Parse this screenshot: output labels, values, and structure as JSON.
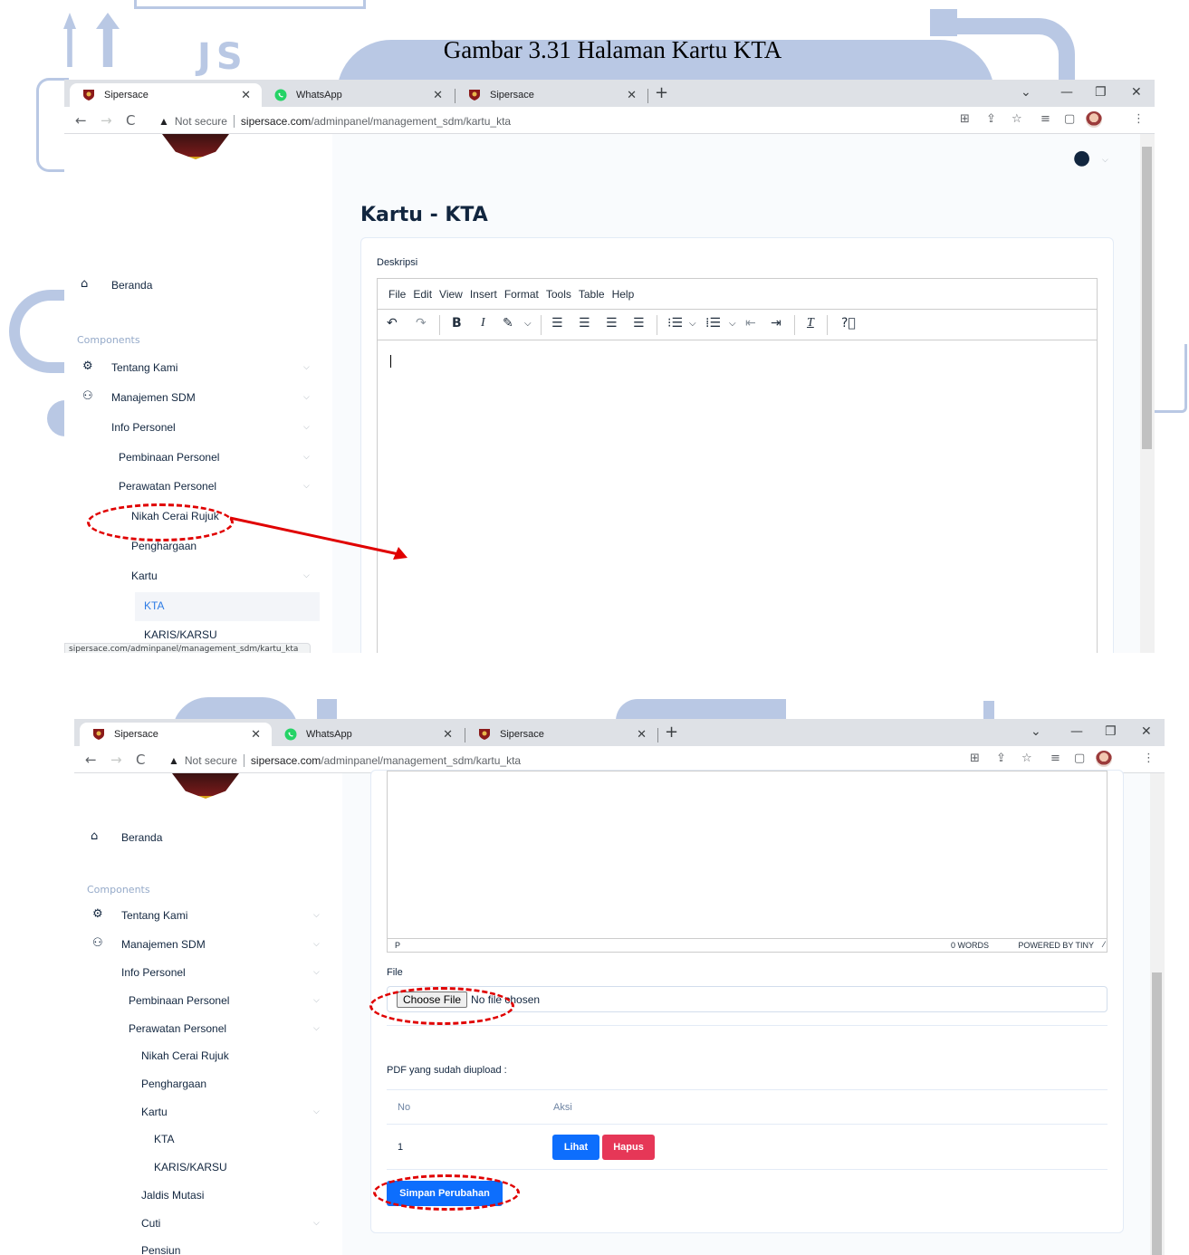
{
  "caption": "Gambar 3.31 Halaman Kartu KTA",
  "watermark_text": "JS",
  "browser": {
    "tabs": [
      {
        "label": "Sipersace",
        "active": true
      },
      {
        "label": "WhatsApp",
        "active": false
      },
      {
        "label": "Sipersace",
        "active": false
      }
    ],
    "new_tab": "+",
    "security_label": "Not secure",
    "url_host": "sipersace.com",
    "url_path": "/adminpanel/management_sdm/kartu_kta",
    "status_url": "sipersace.com/adminpanel/management_sdm/kartu_kta"
  },
  "sidebar": {
    "beranda": "Beranda",
    "section": "Components",
    "items": {
      "tentang": "Tentang Kami",
      "manajemen": "Manajemen SDM",
      "info": "Info Personel",
      "pembinaan": "Pembinaan Personel",
      "perawatan": "Perawatan Personel",
      "nikah": "Nikah Cerai Rujuk",
      "penghargaan": "Penghargaan",
      "kartu": "Kartu",
      "kta": "KTA",
      "karis": "KARIS/KARSU",
      "jaldis": "Jaldis Mutasi",
      "cuti": "Cuti",
      "pensiun": "Pensiun"
    }
  },
  "main": {
    "title": "Kartu - KTA",
    "desc_label": "Deskripsi",
    "menu": [
      "File",
      "Edit",
      "View",
      "Insert",
      "Format",
      "Tools",
      "Table",
      "Help"
    ],
    "editor_status_path": "P",
    "editor_words": "0 WORDS",
    "editor_powered": "POWERED BY TINY",
    "file_label": "File",
    "choose_file": "Choose File",
    "no_file": "No file chosen",
    "uploaded_label": "PDF yang sudah diupload :",
    "table_headers": [
      "No",
      "Aksi"
    ],
    "rows": [
      {
        "no": "1"
      }
    ],
    "btn_lihat": "Lihat",
    "btn_hapus": "Hapus",
    "btn_simpan": "Simpan Perubahan"
  },
  "colors": {
    "primary": "#0d6efd",
    "danger": "#e63757",
    "annotation": "#e00000",
    "watermark": "#b9c8e4"
  }
}
